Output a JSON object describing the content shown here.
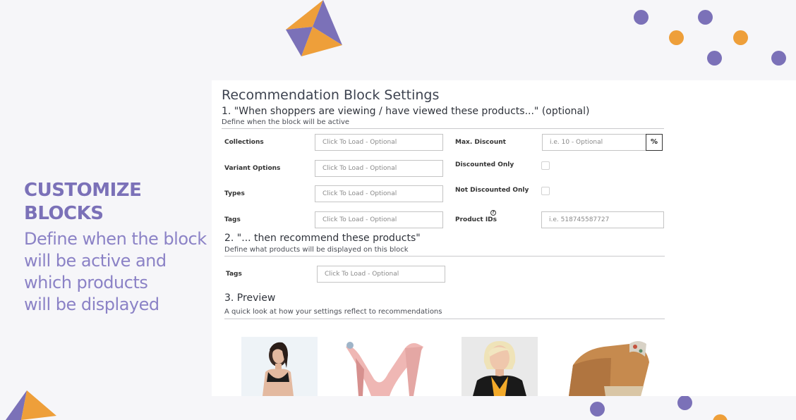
{
  "promo": {
    "title": "CUSTOMIZE\nBLOCKS",
    "subtitle": "Define when the block\nwill be active and\nwhich products\nwill be displayed"
  },
  "panel": {
    "title": "Recommendation Block Settings",
    "section1": {
      "title": "1. \"When shoppers are viewing / have viewed these products...\" (optional)",
      "desc": "Define when the block will be active",
      "collections_label": "Collections",
      "collections_placeholder": "Click To Load - Optional",
      "variant_label": "Variant Options",
      "variant_placeholder": "Click To Load - Optional",
      "types_label": "Types",
      "types_placeholder": "Click To Load - Optional",
      "tags_label": "Tags",
      "tags_placeholder": "Click To Load - Optional",
      "max_discount_label": "Max. Discount",
      "max_discount_placeholder": "i.e. 10 - Optional",
      "percent_label": "%",
      "discounted_only_label": "Discounted Only",
      "not_discounted_only_label": "Not Discounted Only",
      "product_ids_label": "Product IDs",
      "help_glyph": "?",
      "product_ids_placeholder": "i.e. 518745587727"
    },
    "section2": {
      "title": "2. \"... then recommend these products\"",
      "desc": "Define what products will be displayed on this block",
      "tags_label": "Tags",
      "tags_placeholder": "Click To Load - Optional"
    },
    "section3": {
      "title": "3. Preview",
      "desc": "A quick look at how your settings reflect to recommendations"
    }
  },
  "colors": {
    "purple": "#7b71b8",
    "orange": "#ee9f3a",
    "background": "#f6f6f9"
  }
}
